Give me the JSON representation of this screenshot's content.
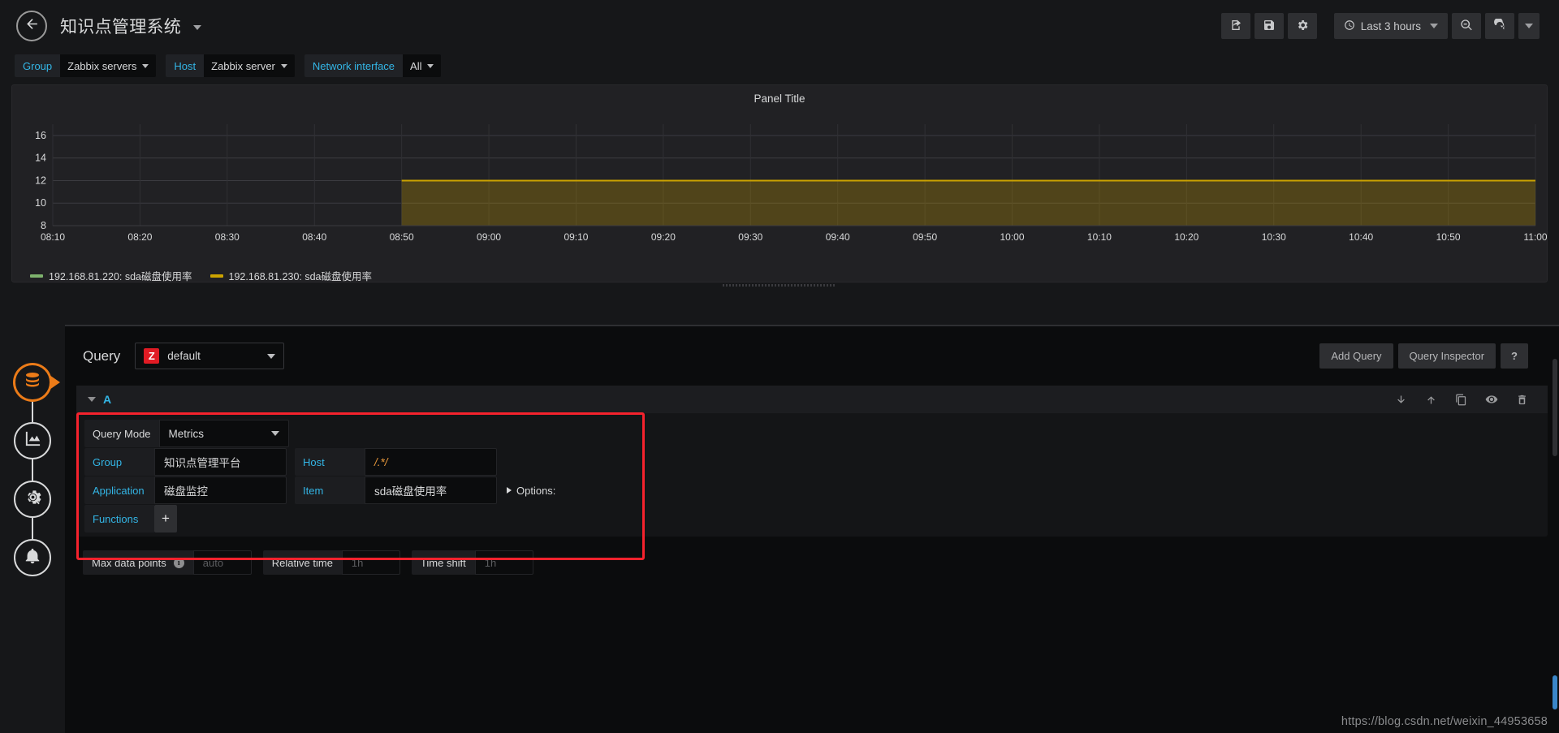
{
  "topnav": {
    "back_icon": "arrow-left-icon",
    "dashboard_title": "知识点管理系统",
    "tools": [
      {
        "name": "share-dashboard-button",
        "icon": "share-icon"
      },
      {
        "name": "save-dashboard-button",
        "icon": "save-icon"
      },
      {
        "name": "dashboard-settings-button",
        "icon": "gear-icon"
      }
    ],
    "time_picker": {
      "label": "Last 3 hours",
      "icon": "clock-icon"
    },
    "zoom_out_button": {
      "name": "zoom-out-button",
      "icon": "search-minus-icon"
    },
    "refresh_button": {
      "name": "refresh-button",
      "icon": "refresh-icon"
    },
    "refresh_interval_caret": "chevron-down-icon"
  },
  "variables": [
    {
      "label": "Group",
      "value": "Zabbix servers"
    },
    {
      "label": "Host",
      "value": "Zabbix server"
    },
    {
      "label": "Network interface",
      "value": "All"
    }
  ],
  "panel": {
    "title": "Panel Title"
  },
  "chart_data": {
    "type": "area",
    "title": "Panel Title",
    "xlabel": "",
    "ylabel": "",
    "ylim": [
      8,
      17
    ],
    "yticks": [
      16,
      14,
      12,
      10,
      8
    ],
    "xticks": [
      "08:10",
      "08:20",
      "08:30",
      "08:40",
      "08:50",
      "09:00",
      "09:10",
      "09:20",
      "09:30",
      "09:40",
      "09:50",
      "10:00",
      "10:10",
      "10:20",
      "10:30",
      "10:40",
      "10:50",
      "11:00"
    ],
    "grid": true,
    "legend_position": "bottom-left",
    "series": [
      {
        "name": "192.168.81.220: sda磁盘使用率",
        "color": "#7eb26d",
        "x": [],
        "values": []
      },
      {
        "name": "192.168.81.230: sda磁盘使用率",
        "color": "#cca300",
        "x": [
          "08:50",
          "09:00",
          "09:10",
          "09:20",
          "09:30",
          "09:40",
          "09:50",
          "10:00",
          "10:10",
          "10:20",
          "10:30",
          "10:40",
          "10:50",
          "11:00"
        ],
        "values": [
          12,
          12,
          12,
          12,
          12,
          12,
          12,
          12,
          12,
          12,
          12,
          12,
          12,
          12
        ]
      }
    ]
  },
  "editor": {
    "query_label": "Query",
    "datasource": {
      "logo_text": "Z",
      "name": "default"
    },
    "add_query_label": "Add Query",
    "query_inspector_label": "Query Inspector",
    "help_label": "?",
    "query_row": {
      "letter": "A",
      "actions": [
        {
          "name": "move-query-down-button",
          "icon": "arrow-down-icon"
        },
        {
          "name": "move-query-up-button",
          "icon": "arrow-up-icon"
        },
        {
          "name": "duplicate-query-button",
          "icon": "copy-icon"
        },
        {
          "name": "toggle-query-visibility-button",
          "icon": "eye-icon"
        },
        {
          "name": "delete-query-button",
          "icon": "trash-icon"
        }
      ]
    },
    "fields": {
      "query_mode_label": "Query Mode",
      "query_mode_value": "Metrics",
      "group_label": "Group",
      "group_value": "知识点管理平台",
      "host_label": "Host",
      "host_value": "/.*/",
      "application_label": "Application",
      "application_value": "磁盘监控",
      "item_label": "Item",
      "item_value": "sda磁盘使用率",
      "options_label": "Options:",
      "functions_label": "Functions",
      "functions_add": "+"
    },
    "options": {
      "max_data_points_label": "Max data points",
      "max_data_points_placeholder": "auto",
      "relative_time_label": "Relative time",
      "relative_time_placeholder": "1h",
      "time_shift_label": "Time shift",
      "time_shift_placeholder": "1h"
    }
  },
  "sidebar": [
    {
      "name": "sidebar-item-queries",
      "icon": "database-icon",
      "active": true
    },
    {
      "name": "sidebar-item-visualization",
      "icon": "area-chart-icon",
      "active": false
    },
    {
      "name": "sidebar-item-general",
      "icon": "gear-wrench-icon",
      "active": false
    },
    {
      "name": "sidebar-item-alert",
      "icon": "bell-icon",
      "active": false
    }
  ],
  "watermark": "https://blog.csdn.net/weixin_44953658"
}
